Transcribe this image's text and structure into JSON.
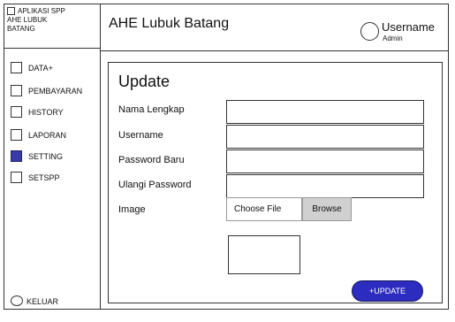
{
  "brand": {
    "line1": "APLIKASI SPP",
    "line2": "AHE LUBUK",
    "line3": "BATANG"
  },
  "sidebar": {
    "items": [
      {
        "label": "DATA+",
        "active": false
      },
      {
        "label": "PEMBAYARAN",
        "active": false
      },
      {
        "label": "HISTORY",
        "active": false
      },
      {
        "label": "LAPORAN",
        "active": false
      },
      {
        "label": "SETTING",
        "active": true
      },
      {
        "label": "SETSPP",
        "active": false
      }
    ],
    "logout_label": "KELUAR"
  },
  "header": {
    "title": "AHE Lubuk Batang",
    "user_name": "Username",
    "user_role": "Admin"
  },
  "form": {
    "title": "Update",
    "fields": [
      {
        "label": "Nama Lengkap",
        "value": ""
      },
      {
        "label": "Username",
        "value": ""
      },
      {
        "label": "Password Baru",
        "value": ""
      },
      {
        "label": "Ulangi Password",
        "value": ""
      }
    ],
    "image_label": "Image",
    "choose_file_label": "Choose File",
    "browse_label": "Browse",
    "update_label": "+UPDATE"
  },
  "colors": {
    "active": "#3a3aa8",
    "button": "#2c2cc0"
  }
}
